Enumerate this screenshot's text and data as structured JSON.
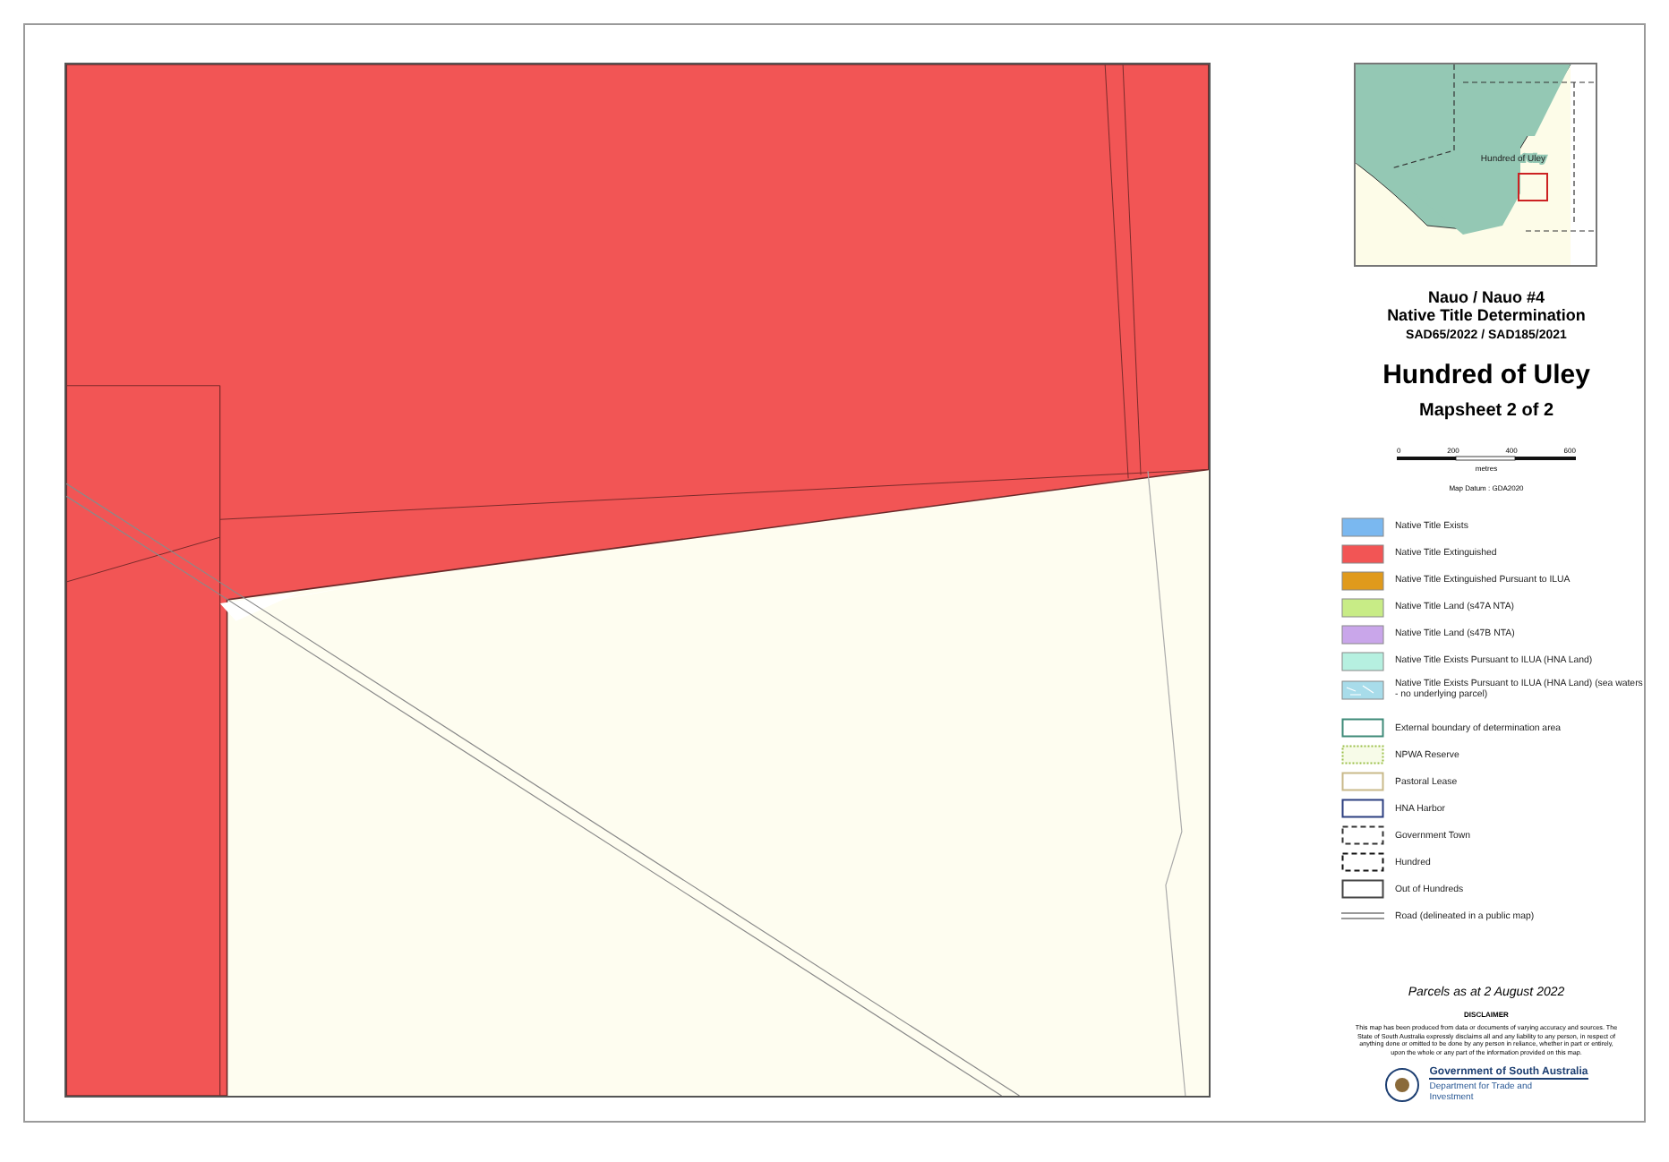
{
  "inset_map": {
    "label": "Hundred of Uley"
  },
  "titles": {
    "claim": "Nauo / Nauo #4",
    "subtitle": "Native Title Determination",
    "case_numbers": "SAD65/2022 / SAD185/2021",
    "hundred": "Hundred of Uley",
    "mapsheet": "Mapsheet 2 of 2"
  },
  "scale_bar": {
    "ticks": [
      "0",
      "200",
      "400",
      "600"
    ],
    "unit": "metres",
    "datum": "Map Datum : GDA2020"
  },
  "legend": [
    {
      "kind": "fill",
      "label": "Native Title Exists",
      "color": "#7ab8f0"
    },
    {
      "kind": "fill",
      "label": "Native Title Extinguished",
      "color": "#f25555"
    },
    {
      "kind": "fill",
      "label": "Native Title Extinguished Pursuant to ILUA",
      "color": "#e09a1c"
    },
    {
      "kind": "fill",
      "label": "Native Title Land (s47A NTA)",
      "color": "#c8ec86"
    },
    {
      "kind": "fill",
      "label": "Native Title Land (s47B NTA)",
      "color": "#c9a6ea"
    },
    {
      "kind": "fill",
      "label": "Native Title Exists Pursuant to ILUA (HNA Land)",
      "color": "#b6f0e0"
    },
    {
      "kind": "hatch",
      "label": "Native Title Exists Pursuant to ILUA (HNA Land) (sea waters - no underlying parcel)",
      "color": "#a8dcea"
    },
    {
      "kind": "outline",
      "label": "External boundary of determination area",
      "color": "#3e8a78"
    },
    {
      "kind": "dotted",
      "label": "NPWA Reserve",
      "color": "#9bbf4a"
    },
    {
      "kind": "outline",
      "label": "Pastoral Lease",
      "color": "#c9b98a"
    },
    {
      "kind": "outline",
      "label": "HNA Harbor",
      "color": "#2c3f80"
    },
    {
      "kind": "dashed",
      "label": "Government Town",
      "color": "#333333"
    },
    {
      "kind": "dashed",
      "label": "Hundred",
      "color": "#111111"
    },
    {
      "kind": "outline",
      "label": "Out of Hundreds",
      "color": "#444444"
    },
    {
      "kind": "road",
      "label": "Road (delineated in a public map)",
      "color": "#999999"
    }
  ],
  "parcels_date": "Parcels as at 2 August 2022",
  "disclaimer": {
    "heading": "DISCLAIMER",
    "text": "This map has been produced from data or documents of varying accuracy and sources. The State of South Australia expressly disclaims all and any liability to any person, in respect of anything done or omitted to be done by any person in reliance, whether in part or entirely, upon the whole or any part of the information provided on this map."
  },
  "logo": {
    "government": "Government of South Australia",
    "department": "Department for Trade and Investment"
  }
}
